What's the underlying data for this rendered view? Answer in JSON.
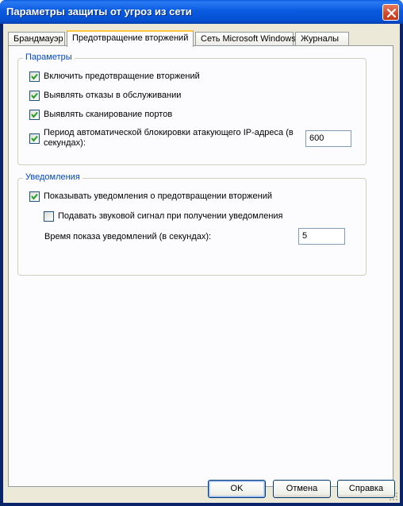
{
  "window": {
    "title": "Параметры защиты от угроз из сети"
  },
  "tabs": [
    {
      "label": "Брандмауэр"
    },
    {
      "label": "Предотвращение вторжений"
    },
    {
      "label": "Сеть Microsoft Windows"
    },
    {
      "label": "Журналы"
    }
  ],
  "params": {
    "title": "Параметры",
    "enable_label": "Включить предотвращение вторжений",
    "enable_checked": true,
    "dos_label": "Выявлять отказы в обслуживании",
    "dos_checked": true,
    "scan_label": "Выявлять сканирование портов",
    "scan_checked": true,
    "block_label_line1": "Период автоматической блокировки атакующего IP-адреса (в",
    "block_label_line2": "секундах):",
    "block_checked": true,
    "block_value": "600"
  },
  "notify": {
    "title": "Уведомления",
    "show_label": "Показывать уведомления о предотвращении вторжений",
    "show_checked": true,
    "sound_label": "Подавать звуковой сигнал при получении уведомления",
    "sound_checked": false,
    "time_label": "Время показа уведомлений (в секундах):",
    "time_value": "5"
  },
  "buttons": {
    "ok": "OK",
    "cancel": "Отмена",
    "help": "Справка"
  }
}
